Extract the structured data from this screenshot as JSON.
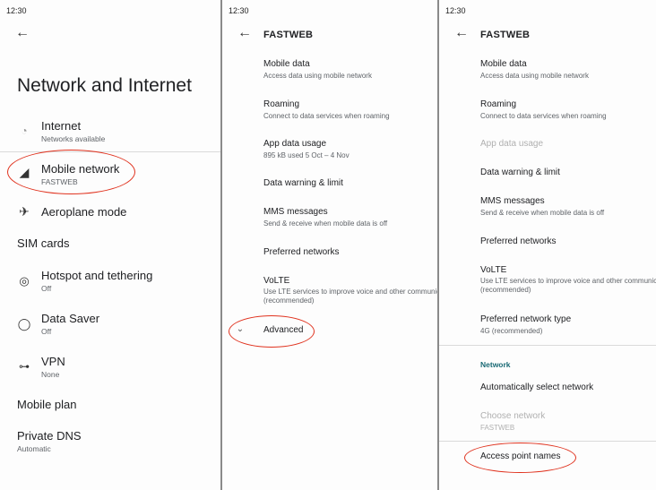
{
  "status_time": "12:30",
  "left": {
    "title": "Network and Internet",
    "internet": {
      "label": "Internet",
      "sub": "Networks available"
    },
    "mobile_network": {
      "label": "Mobile network",
      "sub": "FASTWEB"
    },
    "aeroplane": {
      "label": "Aeroplane mode"
    },
    "sim_cards": {
      "label": "SIM cards"
    },
    "hotspot": {
      "label": "Hotspot and tethering",
      "sub": "Off"
    },
    "data_saver": {
      "label": "Data Saver",
      "sub": "Off"
    },
    "vpn": {
      "label": "VPN",
      "sub": "None"
    },
    "mobile_plan": {
      "label": "Mobile plan"
    },
    "private_dns": {
      "label": "Private DNS",
      "sub": "Automatic"
    }
  },
  "middle": {
    "title": "FASTWEB",
    "mobile_data": {
      "label": "Mobile data",
      "sub": "Access data using mobile network"
    },
    "roaming": {
      "label": "Roaming",
      "sub": "Connect to data services when roaming"
    },
    "app_data_usage": {
      "label": "App data usage",
      "sub": "895 kB used 5 Oct – 4 Nov"
    },
    "data_warning": {
      "label": "Data warning & limit"
    },
    "mms": {
      "label": "MMS messages",
      "sub": "Send & receive when mobile data is off"
    },
    "preferred_networks": {
      "label": "Preferred networks"
    },
    "volte": {
      "label": "VoLTE",
      "sub": "Use LTE services to improve voice and other communications",
      "sub2": "(recommended)"
    },
    "advanced": {
      "label": "Advanced"
    }
  },
  "right": {
    "title": "FASTWEB",
    "mobile_data": {
      "label": "Mobile data",
      "sub": "Access data using mobile network"
    },
    "roaming": {
      "label": "Roaming",
      "sub": "Connect to data services when roaming"
    },
    "app_data_usage": {
      "label": "App data usage"
    },
    "data_warning": {
      "label": "Data warning & limit"
    },
    "mms": {
      "label": "MMS messages",
      "sub": "Send & receive when mobile data is off"
    },
    "preferred_networks": {
      "label": "Preferred networks"
    },
    "volte": {
      "label": "VoLTE",
      "sub": "Use LTE services to improve voice and other communications",
      "sub2": "(recommended)"
    },
    "preferred_type": {
      "label": "Preferred network type",
      "sub": "4G (recommended)"
    },
    "network_category": "Network",
    "auto_select": {
      "label": "Automatically select network"
    },
    "choose_network": {
      "label": "Choose network",
      "sub": "FASTWEB"
    },
    "apn": {
      "label": "Access point names"
    }
  },
  "colors": {
    "highlight": "#e0321e",
    "category": "#1a6a75"
  },
  "icons": [
    "back-arrow-icon",
    "wifi-question-icon",
    "signal-icon",
    "airplane-icon",
    "hotspot-icon",
    "data-saver-icon",
    "vpn-key-icon",
    "chevron-down-icon"
  ]
}
